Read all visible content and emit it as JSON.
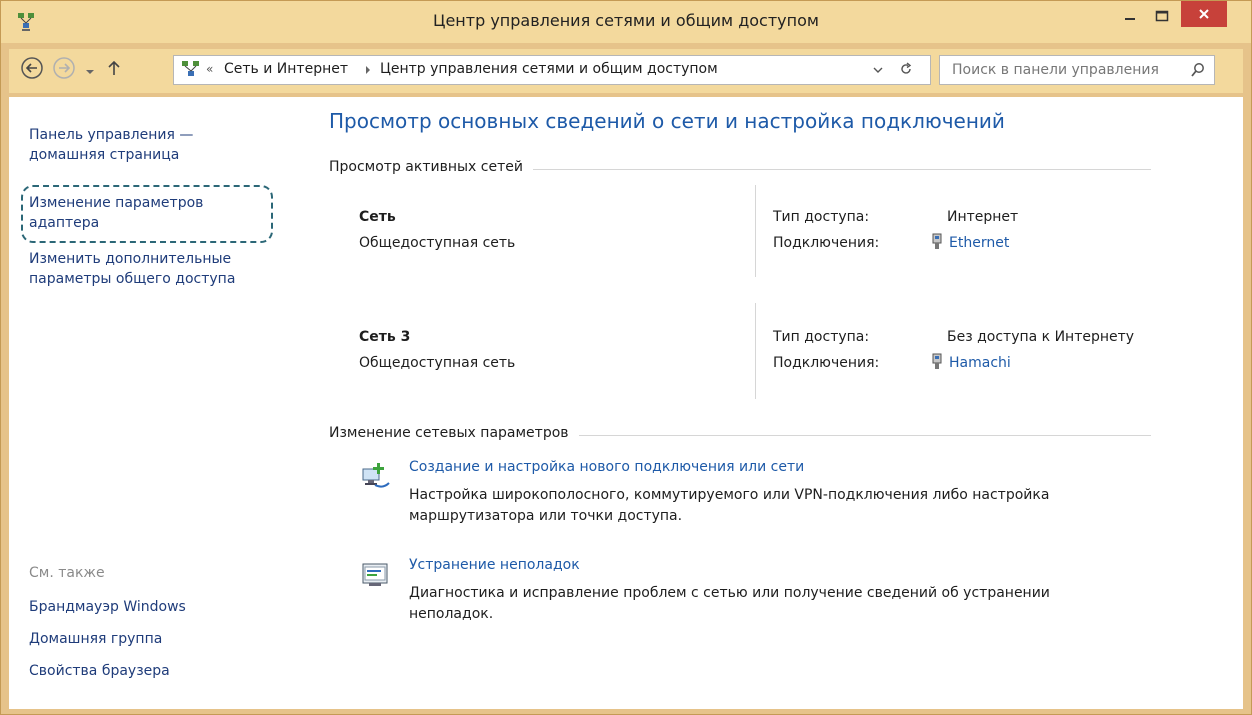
{
  "window": {
    "title": "Центр управления сетями и общим доступом",
    "controls": {
      "minimize": "minimize-icon",
      "maximize": "maximize-icon",
      "close": "close-icon"
    }
  },
  "nav": {
    "breadcrumb_overflow": "«",
    "breadcrumb": [
      "Сеть и Интернет",
      "Центр управления сетями и общим доступом"
    ],
    "search_placeholder": "Поиск в панели управления"
  },
  "sidebar": {
    "home_link": [
      "Панель управления —",
      "домашняя страница"
    ],
    "adapter_link": [
      "Изменение параметров",
      "адаптера"
    ],
    "sharing_link": [
      "Изменить дополнительные",
      "параметры общего доступа"
    ],
    "see_also_label": "См. также",
    "see_also": [
      "Брандмауэр Windows",
      "Домашняя группа",
      "Свойства браузера"
    ]
  },
  "main": {
    "title": "Просмотр основных сведений о сети и настройка подключений",
    "active_networks_header": "Просмотр активных сетей",
    "networks": [
      {
        "name": "Сеть",
        "category": "Общедоступная сеть",
        "access_label": "Тип доступа:",
        "access_value": "Интернет",
        "connections_label": "Подключения:",
        "connection": "Ethernet"
      },
      {
        "name": "Сеть 3",
        "category": "Общедоступная сеть",
        "access_label": "Тип доступа:",
        "access_value": "Без доступа к Интернету",
        "connections_label": "Подключения:",
        "connection": "Hamachi"
      }
    ],
    "change_settings_header": "Изменение сетевых параметров",
    "tasks": [
      {
        "link": "Создание и настройка нового подключения или сети",
        "desc": [
          "Настройка широкополосного, коммутируемого или VPN-подключения либо настройка",
          "маршрутизатора или точки доступа."
        ]
      },
      {
        "link": "Устранение неполадок",
        "desc": [
          "Диагностика и исправление проблем с сетью или получение сведений об устранении",
          "неполадок."
        ]
      }
    ]
  },
  "colors": {
    "frame": "#f3d99d",
    "link": "#1e5aa8",
    "close": "#c7413a",
    "highlight_dash": "#2b6777"
  }
}
